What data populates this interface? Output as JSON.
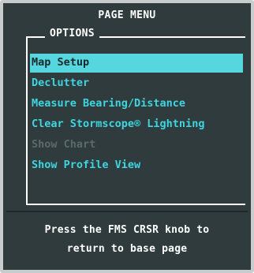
{
  "header": {
    "title": "PAGE MENU"
  },
  "options": {
    "label": "OPTIONS",
    "items": [
      {
        "label": "Map Setup",
        "state": "selected"
      },
      {
        "label": "Declutter",
        "state": "enabled"
      },
      {
        "label": "Measure Bearing/Distance",
        "state": "enabled"
      },
      {
        "label": "Clear Stormscope® Lightning",
        "state": "enabled"
      },
      {
        "label": "Show Chart",
        "state": "disabled"
      },
      {
        "label": "Show Profile View",
        "state": "enabled"
      }
    ]
  },
  "footer": {
    "line1": "Press the FMS CRSR knob to",
    "line2": "return to base page"
  },
  "colors": {
    "background": "#2f3b3d",
    "frame": "#c9cccc",
    "menu_text": "#3fd5e0",
    "highlight": "#56d6df",
    "disabled_text": "#5b6a6c",
    "header_text": "#ffffff"
  }
}
